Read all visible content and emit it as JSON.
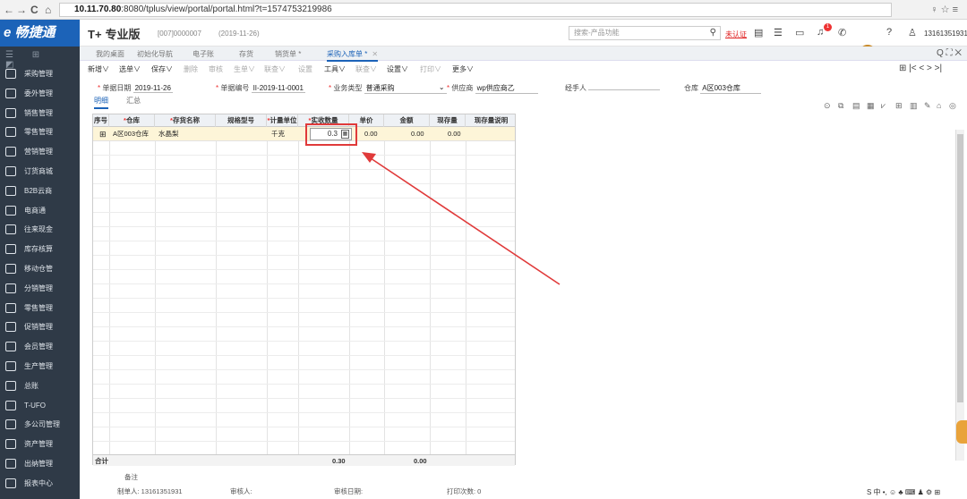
{
  "browser": {
    "back": "←",
    "forward": "→",
    "reload": "C",
    "home": "⌂",
    "url_host": "10.11.70.80",
    "url_rest": ":8080/tplus/view/portal/portal.html?t=1574753219986",
    "icons": "♀ ☆ ≡"
  },
  "header": {
    "logo": "e 畅捷通",
    "brand": "T+",
    "edition": "专业版",
    "account": "[007]0000007",
    "account_date": "(2019-11-26)",
    "search_placeholder": "搜索-产品功能",
    "auth_link": "未认证",
    "notify_count": "1",
    "user": "13161351931"
  },
  "sidebar": {
    "top": "☰ ⊞ ◩",
    "items": [
      "采购管理",
      "委外管理",
      "销售管理",
      "零售管理",
      "营销管理",
      "订货商城",
      "B2B云商",
      "电商通",
      "往来现金",
      "库存核算",
      "移动仓管",
      "分销管理",
      "零售管理",
      "促销管理",
      "会员管理",
      "生产管理",
      "总账",
      "T-UFO",
      "多公司管理",
      "资产管理",
      "出纳管理",
      "报表中心"
    ]
  },
  "tabs": {
    "items": [
      "我的桌面",
      "初始化导航",
      "电子账",
      "存货",
      "销货单 *",
      "采购入库单 *"
    ],
    "right_icons": "Q ⛶ ✕"
  },
  "toolbar": {
    "items": [
      "新增∨",
      "选单∨",
      "保存∨",
      "删除",
      "审核",
      "生单∨",
      "联查∨",
      "设置",
      "工具∨",
      "联查∨",
      "设置∨",
      "打印∨",
      "更多∨"
    ],
    "right_icons": "⊞ |< < > >|"
  },
  "form": {
    "doc_date_label": "单据日期",
    "doc_date": "2019-11-26",
    "doc_no_label": "单据编号",
    "doc_no": "II-2019-11-0001",
    "biz_type_label": "业务类型",
    "biz_type": "普通采购",
    "supplier_label": "供应商",
    "supplier": "wp供应商乙",
    "handler_label": "经手人",
    "warehouse_label": "仓库",
    "warehouse": "A区003仓库"
  },
  "subtabs": [
    "明细",
    "汇总"
  ],
  "grid": {
    "headers": [
      "序号",
      "仓库",
      "存货名称",
      "规格型号",
      "计量单位",
      "实收数量",
      "单价",
      "金额",
      "现存量",
      "现存量说明"
    ],
    "row": {
      "warehouse": "A区003仓库",
      "item_name": "水晶梨",
      "unit": "千克",
      "qty": "0.3",
      "price": "0.00",
      "amount": "0.00",
      "stock": "0.00"
    },
    "total_label": "合计",
    "total_qty": "0.30",
    "total_amount": "0.00"
  },
  "footer": {
    "remark_label": "备注",
    "maker_label": "制单人",
    "maker": "13161351931",
    "auditor_label": "审核人",
    "audit_date_label": "审核日期",
    "print_count_label": "打印次数",
    "print_count": "0"
  },
  "tray": "S 中 •, ☺ ♣ ⌨ ♟ ⚙ ⊞",
  "colors": {
    "accent": "#1c63b8",
    "sidebar": "#2f3a47",
    "highlight": "#e03a3a"
  }
}
